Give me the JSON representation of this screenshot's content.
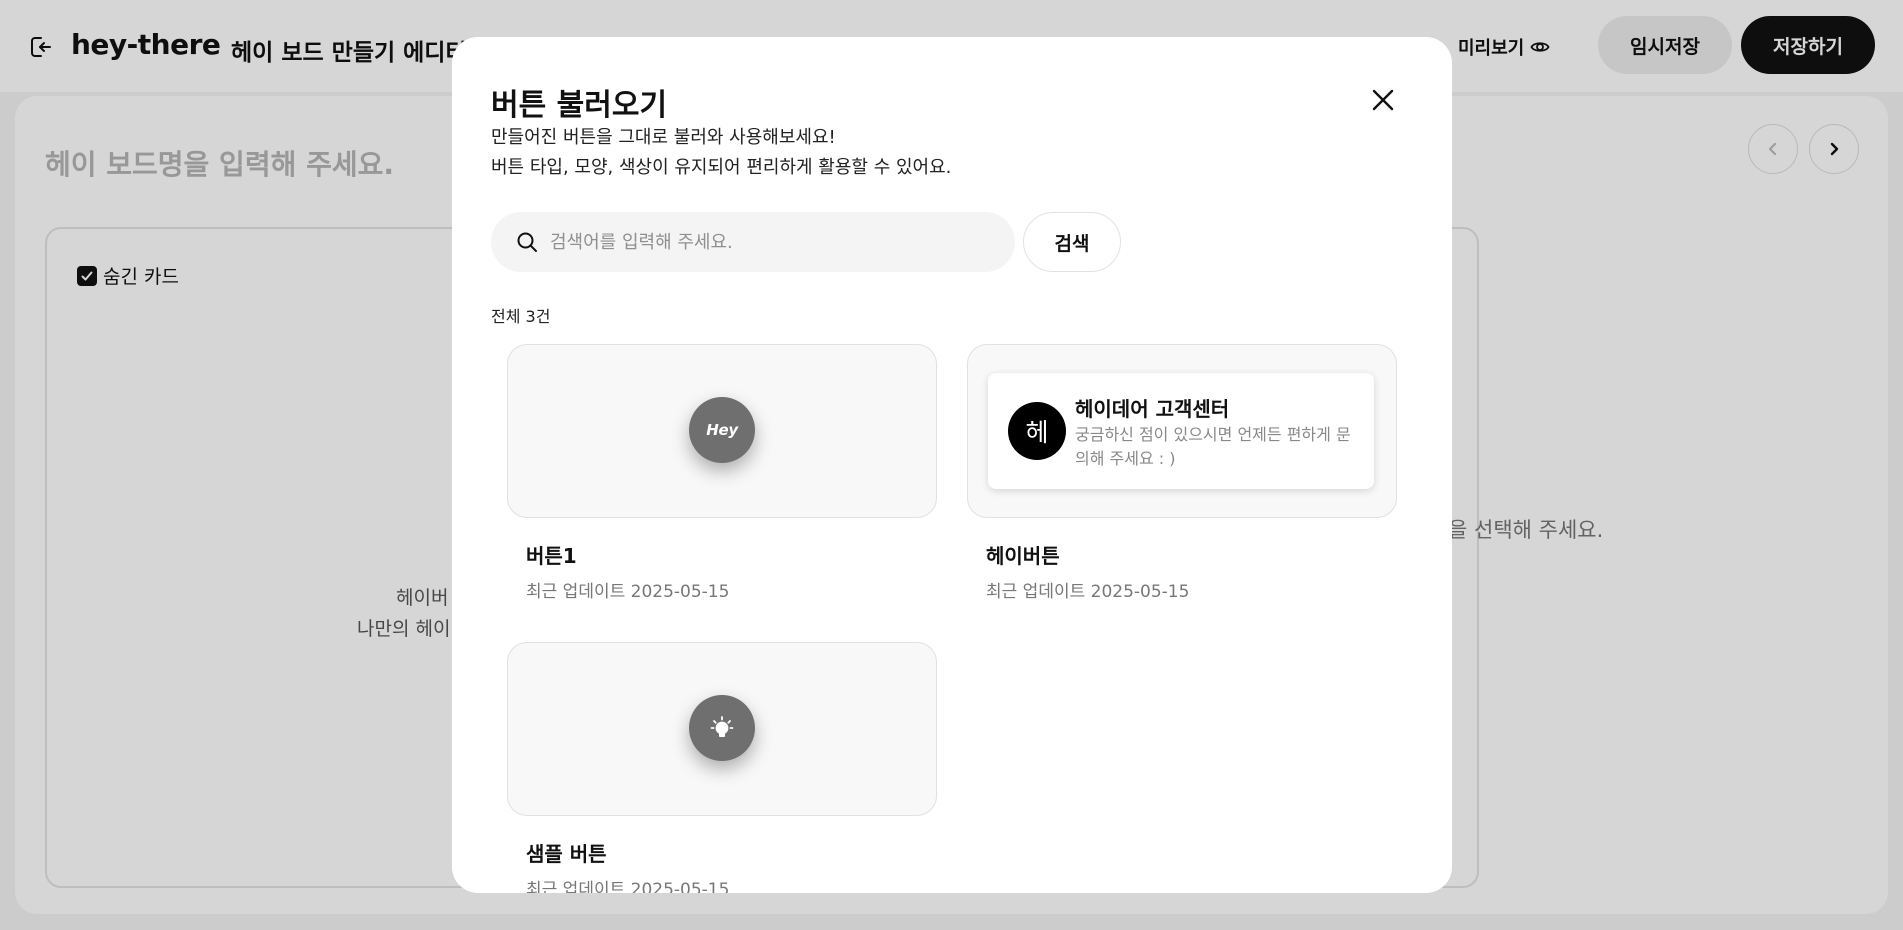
{
  "header": {
    "logo": "hey-there",
    "editor_title": "헤이 보드 만들기 에디터",
    "preview_label": "미리보기",
    "temp_save_label": "임시저장",
    "save_label": "저장하기"
  },
  "board": {
    "name_placeholder": "헤이 보드명을 입력해 주세요.",
    "hidden_card_label": "숨긴 카드",
    "hidden_card_checked": true,
    "empty_line1": "헤이버",
    "empty_line2": "나만의 헤이",
    "right_hint": "을 선택해 주세요."
  },
  "modal": {
    "title": "버튼 불러오기",
    "description_line1": "만들어진 버튼을 그대로 불러와 사용해보세요!",
    "description_line2": "버튼 타입, 모양, 색상이 유지되어 편리하게 활용할 수 있어요.",
    "search_placeholder": "검색어를 입력해 주세요.",
    "search_value": "",
    "search_button": "검색",
    "total_label": "전체 3건",
    "items": [
      {
        "name": "버튼1",
        "date": "최근 업데이트 2025-05-15",
        "preview_type": "circle-logo",
        "preview_text": "Hey"
      },
      {
        "name": "헤이버튼",
        "date": "최근 업데이트 2025-05-15",
        "preview_type": "card",
        "card_avatar": "헤",
        "card_title": "헤이데어 고객센터",
        "card_desc": "궁금하신 점이 있으시면 언제든 편하게 문의해 주세요 : )"
      },
      {
        "name": "샘플 버튼",
        "date": "최근 업데이트 2025-05-15",
        "preview_type": "circle-icon",
        "icon": "lightbulb-icon"
      }
    ]
  },
  "colors": {
    "primary": "#111111",
    "overlay": "rgba(0,0,0,0.16)",
    "button_gray": "#6f6f6f",
    "muted_text": "#777777"
  }
}
